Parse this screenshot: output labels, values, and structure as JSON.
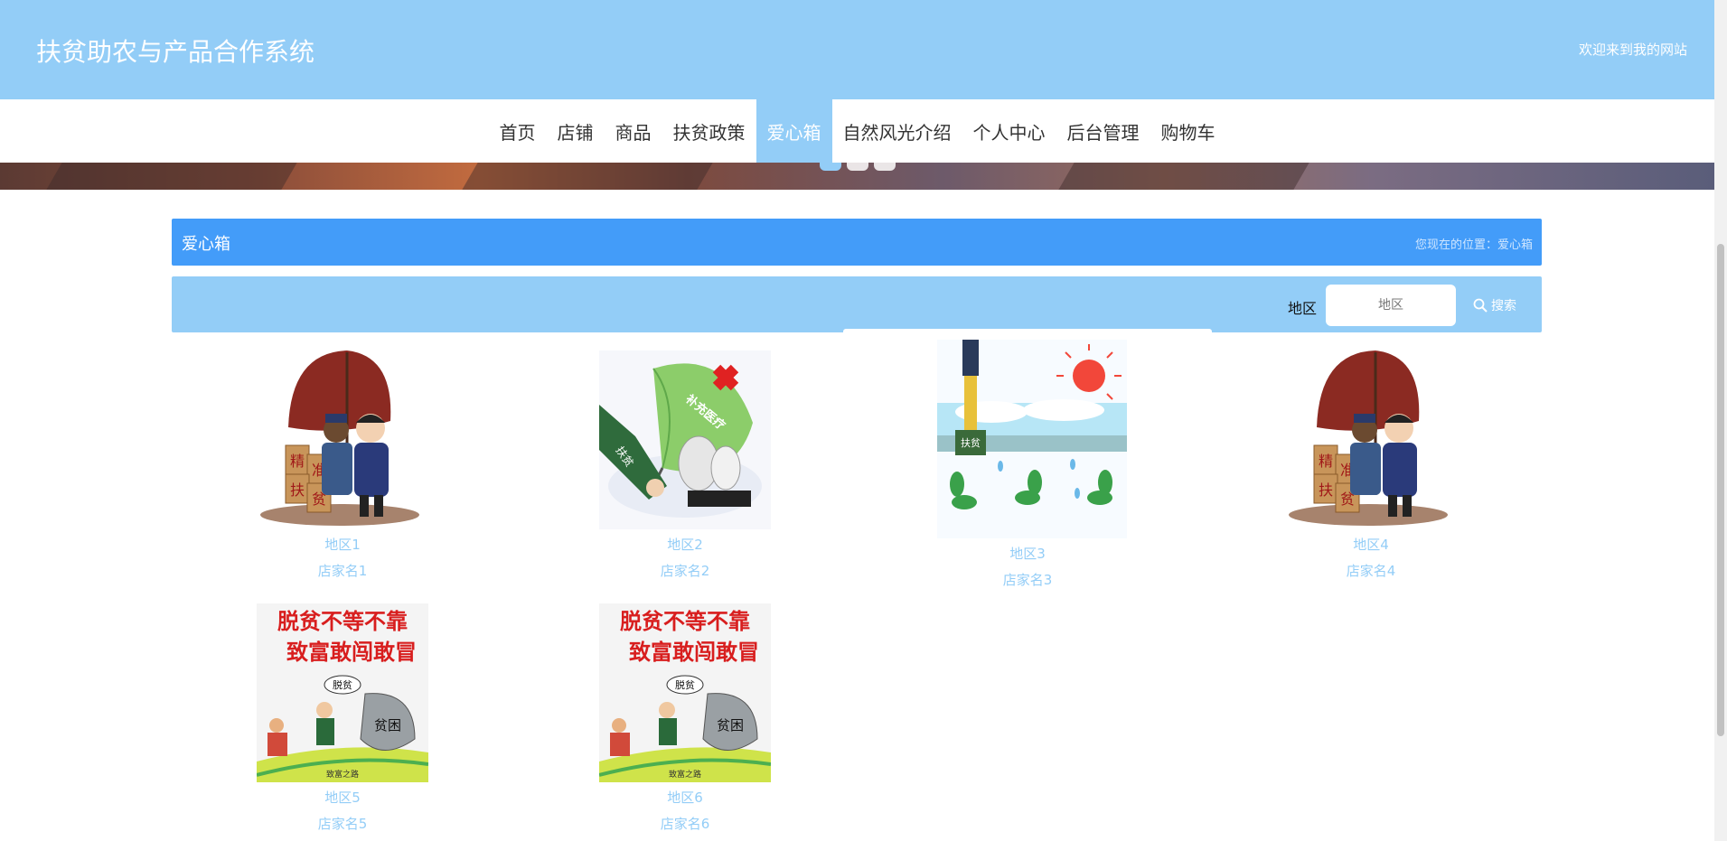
{
  "header": {
    "title": "扶贫助农与产品合作系统",
    "welcome": "欢迎来到我的网站"
  },
  "nav": {
    "items": [
      {
        "label": "首页"
      },
      {
        "label": "店铺"
      },
      {
        "label": "商品"
      },
      {
        "label": "扶贫政策"
      },
      {
        "label": "爱心箱"
      },
      {
        "label": "自然风光介绍"
      },
      {
        "label": "个人中心"
      },
      {
        "label": "后台管理"
      },
      {
        "label": "购物车"
      }
    ],
    "active": "爱心箱"
  },
  "section": {
    "title": "爱心箱",
    "breadcrumb": "您现在的位置：爱心箱"
  },
  "search": {
    "label": "地区",
    "placeholder": "地区",
    "button": "搜索"
  },
  "cards": [
    {
      "region": "地区1",
      "shop": "店家名1",
      "image": "umbrella-handshake-poverty-illustration"
    },
    {
      "region": "地区2",
      "shop": "店家名2",
      "image": "medical-umbrella-illustration"
    },
    {
      "region": "地区3",
      "shop": "店家名3",
      "image": "yuan-watering-seedlings-illustration"
    },
    {
      "region": "地区4",
      "shop": "店家名4",
      "image": "umbrella-handshake-poverty-illustration"
    },
    {
      "region": "地区5",
      "shop": "店家名5",
      "image": "poverty-escape-poster"
    },
    {
      "region": "地区6",
      "shop": "店家名6",
      "image": "poverty-escape-poster"
    }
  ],
  "image_text": {
    "box_chars": [
      "精",
      "准",
      "扶",
      "贫"
    ],
    "umbrella_text": "补充医疗",
    "arm_text": "扶贫",
    "pipe_text": "扶贫",
    "poster_line1": "脱贫不等不靠",
    "poster_line2": "致富敢闯敢冒",
    "speech_bubble": "脱贫",
    "rock_text": "贫困",
    "road_text": "致富之路"
  },
  "colors": {
    "primary": "#93cdf7",
    "accent": "#439cf9"
  }
}
